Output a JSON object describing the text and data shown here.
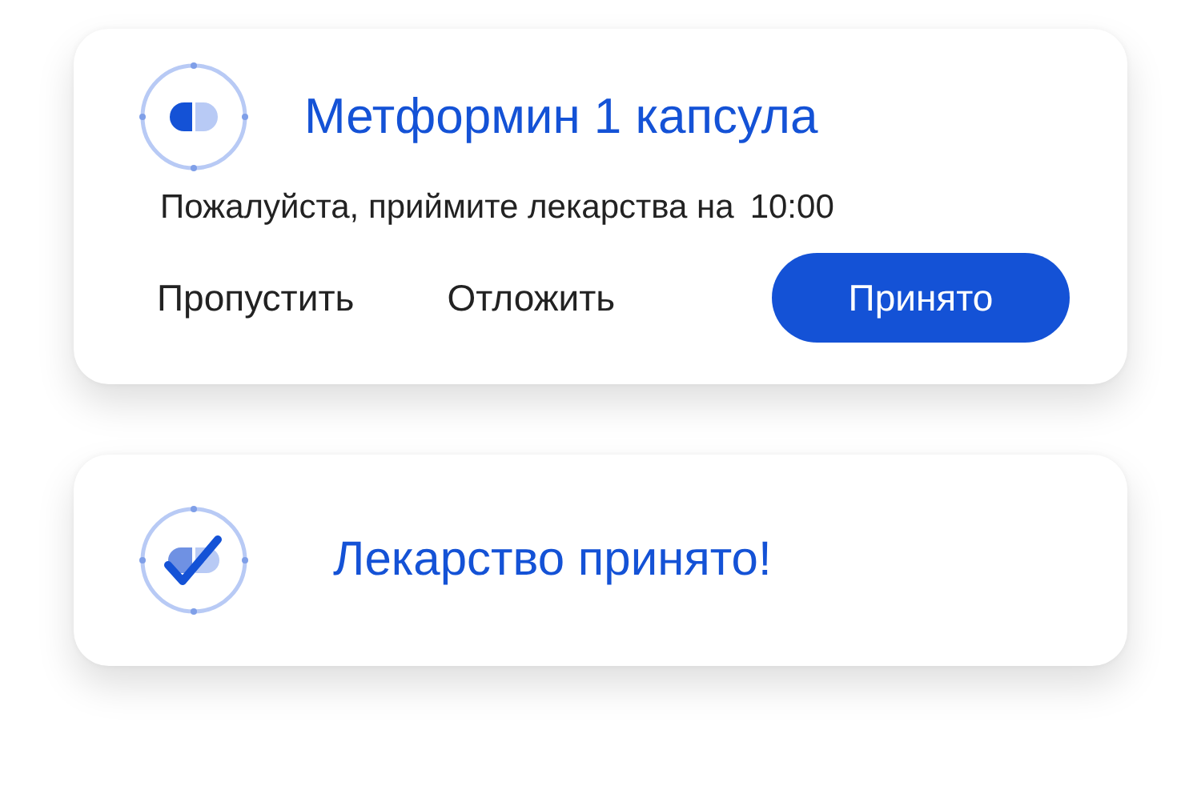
{
  "reminder": {
    "title": "Метформин 1 капсула",
    "message": "Пожалуйста, приймите лекарства на",
    "time": "10:00",
    "buttons": [
      {
        "label": "Пропустить",
        "kind": "text"
      },
      {
        "label": "Отложить",
        "kind": "text"
      },
      {
        "label": "Принято",
        "kind": "primary"
      }
    ]
  },
  "confirmation": {
    "title": "Лекарство принято!"
  }
}
